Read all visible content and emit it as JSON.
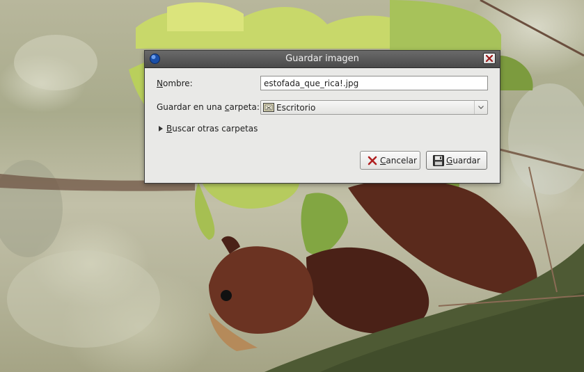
{
  "dialog": {
    "title": "Guardar imagen",
    "name_label_mnemonic": "N",
    "name_label_rest": "ombre:",
    "name_value": "estofada_que_rica!.jpg",
    "folder_label_before": "Guardar en una ",
    "folder_label_mnemonic": "c",
    "folder_label_after": "arpeta:",
    "folder_selected": "Escritorio",
    "expander_mnemonic": "B",
    "expander_rest": "uscar otras carpetas",
    "cancel_mnemonic": "C",
    "cancel_rest": "ancelar",
    "save_mnemonic": "G",
    "save_rest": "uardar"
  },
  "icons": {
    "app": "globe-icon",
    "close": "close-icon",
    "folder": "folder-icon",
    "expander": "triangle-right-icon",
    "combo_arrow": "chevron-down-icon",
    "cancel": "cancel-x-icon",
    "save": "floppy-disk-icon"
  },
  "colors": {
    "titlebar": "#4a4a4a",
    "dialog_bg": "#e9e9e7",
    "title_text": "#f2f2f2"
  }
}
